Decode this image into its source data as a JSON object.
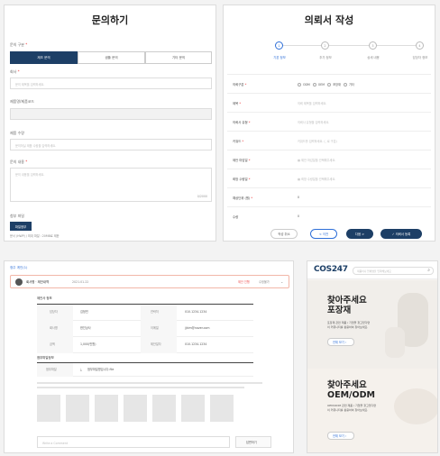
{
  "inquiry": {
    "title": "문의하기",
    "type_label": "문의 구분",
    "type_options": [
      "제조 문의",
      "샘플 문의",
      "기타 문의"
    ],
    "company_label": "회사",
    "company_placeholder": "문의 제목을 입력하세요.",
    "product_label": "제품명/제품코드",
    "quantity_label": "제품 수량",
    "quantity_placeholder": "문의하실 제품 수량을 입력하세요.",
    "content_label": "문의 내용",
    "content_placeholder": "문의 내용을 입력하세요.",
    "counter": "0/2000",
    "attach_label": "첨부 파일",
    "attach_button": "파일첨부",
    "attach_note": "문서 (HWP) / 최대 파일 : 20MB로 제한"
  },
  "request": {
    "title": "의뢰서 작성",
    "steps": [
      {
        "num": "1",
        "label": "기본 정보"
      },
      {
        "num": "2",
        "label": "추가 정보"
      },
      {
        "num": "3",
        "label": "상세 내용"
      },
      {
        "num": "4",
        "label": "담당자 정보"
      }
    ],
    "fields": [
      {
        "label": "의뢰구분",
        "value": ""
      },
      {
        "label": "제목",
        "value": "의뢰 제목을 입력하세요."
      },
      {
        "label": "의뢰사 유형",
        "value": "의뢰사 유형을 입력하세요."
      },
      {
        "label": "키워드",
        "value": "키워드를 입력하세요. (, 로 구분)"
      },
      {
        "label": "제안 마감일",
        "value": "제안 마감일을 선택해주세요."
      },
      {
        "label": "희망 수량일",
        "value": "희망 수량일을 선택해주세요."
      },
      {
        "label": "예상단위 (원)",
        "value": "0"
      },
      {
        "label": "수량",
        "value": "0"
      }
    ],
    "kind_options": [
      "ODM",
      "OEM",
      "포장재",
      "기타"
    ],
    "buttons": {
      "cancel": "작성 취소",
      "prev": "< 이전",
      "next": "다음 >",
      "submit": "✓ 의뢰서 등록"
    }
  },
  "detail": {
    "breadcrumb": "정주 게인(1)",
    "header_name": "회사명 · 제안내역",
    "header_date": "2021.01.22",
    "header_status": "제안 진행",
    "header_count": "수정불가",
    "section_info": "제안사 정보",
    "info_rows": [
      [
        "담당자",
        "김정민",
        "연락처",
        "010.1234.1234"
      ],
      [
        "회사명",
        "한진상사",
        "이메일",
        "jjkim@naver.com"
      ],
      [
        "금액",
        "1,000(만원)",
        "제안일자",
        "010.1234.1234"
      ]
    ],
    "attach_section": "첨부파일정보",
    "attach_label": "첨부파일",
    "attach_file": "첨부파일명입니다.file",
    "comment_placeholder": "Write a Comment",
    "comment_button": "답변하기"
  },
  "app": {
    "logo": "COS247",
    "search_placeholder": "제품이나 업체명을 입력해보세요",
    "card1": {
      "title_1": "찾아주세요",
      "title_2": "포장재",
      "desc_1": "포장재 관련 제품 / 기업을 찾고있다면",
      "desc_2": "이 커뮤니티를 활용하여 찾아보세요.",
      "link": "전체 보기 ›"
    },
    "card2": {
      "title_1": "찾아주세요",
      "title_2": "OEM/ODM",
      "desc_1": "OEM/ODM 관련 제품 / 기업을 찾고있다면",
      "desc_2": "이 커뮤니티를 활용하여 찾아보세요.",
      "link": "전체 보기 ›"
    }
  }
}
